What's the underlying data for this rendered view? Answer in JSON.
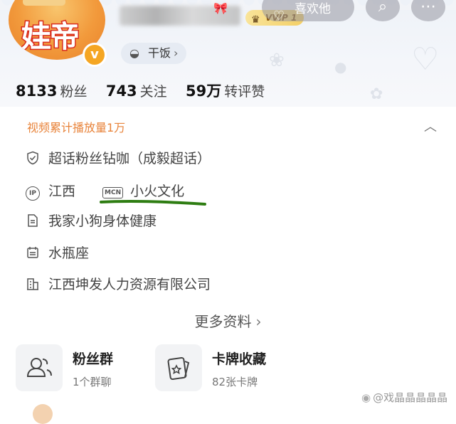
{
  "header": {
    "avatar_text": "娃帝",
    "verified_mark": "v",
    "vip_label": "VVIP 1",
    "like_button_label": "喜欢他",
    "tag_label": "干饭",
    "tag_chevron": "›",
    "icons": {
      "like": "heart-icon",
      "search": "search-icon",
      "more": "more-icon",
      "bowl": "bowl-icon",
      "crown": "crown-icon",
      "bow": "bow-icon"
    }
  },
  "stats": [
    {
      "value": "8133",
      "label": "粉丝"
    },
    {
      "value": "743",
      "label": "关注"
    },
    {
      "value": "59万",
      "label": "转评赞"
    }
  ],
  "info": {
    "highlight": "视频累计播放量1万",
    "super_topic": "超话粉丝钻咖（成毅超话）",
    "ip_label": "IP",
    "ip_location": "江西",
    "mcn_label": "MCN",
    "mcn_name": "小火文化",
    "bio": "我家小狗身体健康",
    "zodiac": "水瓶座",
    "company": "江西坤发人力资源有限公司"
  },
  "more_info_label": "更多资料",
  "cards": [
    {
      "title": "粉丝群",
      "subtitle": "1个群聊",
      "icon": "fan-group-icon"
    },
    {
      "title": "卡牌收藏",
      "subtitle": "82张卡牌",
      "icon": "card-collection-icon"
    }
  ],
  "watermark": "@戏晶晶晶晶晶",
  "colors": {
    "highlight": "#e8833a",
    "underline_mark": "#2e7d12",
    "vip_gold": "#f3cf66",
    "verified_orange": "#f5a623"
  }
}
